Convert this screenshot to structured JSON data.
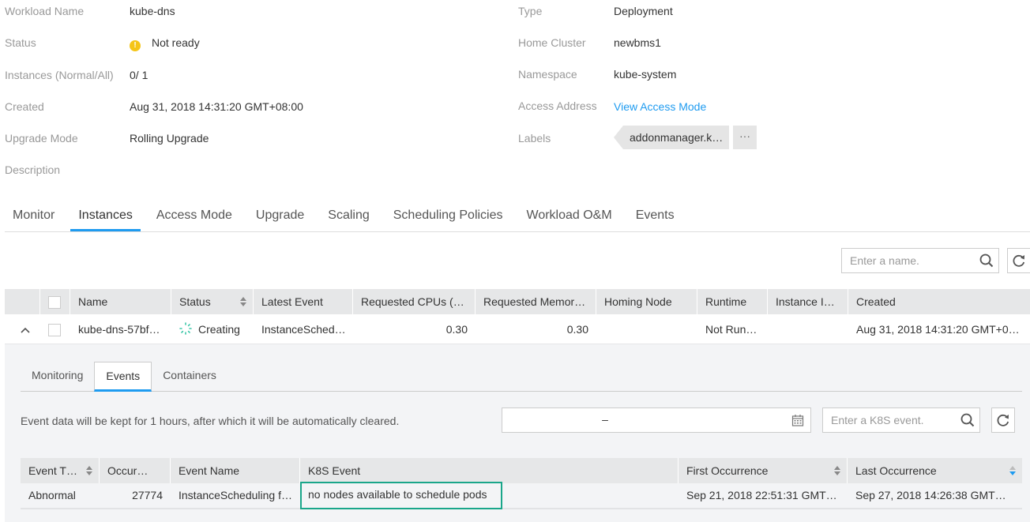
{
  "details_left": [
    {
      "label": "Workload Name",
      "value": "kube-dns"
    },
    {
      "label": "Status",
      "value": "Not ready",
      "icon": "warning-icon",
      "icon_color": "#f5c518"
    },
    {
      "label": "Instances (Normal/All)",
      "value": "0/ 1"
    },
    {
      "label": "Created",
      "value": "Aug 31, 2018 14:31:20 GMT+08:00"
    },
    {
      "label": "Upgrade Mode",
      "value": "Rolling Upgrade"
    },
    {
      "label": "Description",
      "value": ""
    }
  ],
  "details_right": [
    {
      "label": "Type",
      "value": "Deployment"
    },
    {
      "label": "Home Cluster",
      "value": "newbms1"
    },
    {
      "label": "Namespace",
      "value": "kube-system"
    },
    {
      "label": "Access Address",
      "value": "View Access Mode"
    },
    {
      "label": "Labels",
      "value": "addonmanager.k…",
      "more": "···"
    }
  ],
  "tabs": [
    {
      "label": "Monitor",
      "active": false
    },
    {
      "label": "Instances",
      "active": true
    },
    {
      "label": "Access Mode",
      "active": false
    },
    {
      "label": "Upgrade",
      "active": false
    },
    {
      "label": "Scaling",
      "active": false
    },
    {
      "label": "Scheduling Policies",
      "active": false
    },
    {
      "label": "Workload O&M",
      "active": false
    },
    {
      "label": "Events",
      "active": false
    }
  ],
  "instances": {
    "search_placeholder": "Enter a name.",
    "columns": [
      "Name",
      "Status",
      "Latest Event",
      "Requested CPUs (…",
      "Requested Memor…",
      "Homing Node",
      "Runtime",
      "Instance I…",
      "Created"
    ],
    "rows": [
      {
        "name": "kube-dns-57bf…",
        "status": "Creating",
        "latest_event": "InstanceSched…",
        "cpus": "0.30",
        "memory": "0.30",
        "homing_node": "",
        "runtime": "Not Run…",
        "instance_ip": "",
        "created": "Aug 31, 2018 14:31:20 GMT+0…"
      }
    ]
  },
  "expanded": {
    "subtabs": [
      {
        "label": "Monitoring",
        "active": false
      },
      {
        "label": "Events",
        "active": true
      },
      {
        "label": "Containers",
        "active": false
      }
    ],
    "info_text": "Event data will be kept for 1 hours, after which it will be automatically cleared.",
    "date_range_separator": "–",
    "event_search_placeholder": "Enter a K8S event.",
    "event_columns": [
      "Event T…",
      "Occur…",
      "Event Name",
      "K8S Event",
      "First Occurrence",
      "Last Occurrence"
    ],
    "event_rows": [
      {
        "type": "Abnormal",
        "occurrences": "27774",
        "event_name": "InstanceScheduling f…",
        "k8s_event": "no nodes available to schedule pods",
        "first_occurrence": "Sep 21, 2018 22:51:31 GMT…",
        "last_occurrence": "Sep 27, 2018 14:26:38 GMT…"
      }
    ]
  },
  "colors": {
    "accent": "#1e9bf0",
    "warning": "#f5c518",
    "creating": "#3cc7a8",
    "highlight": "#1aa68a"
  }
}
